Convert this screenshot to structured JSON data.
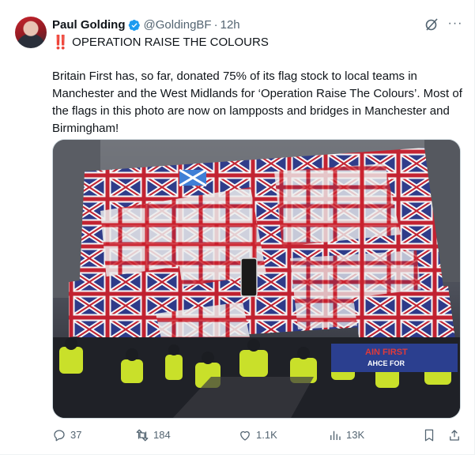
{
  "tweet": {
    "author_name": "Paul Golding",
    "handle": "@GoldingBF",
    "separator": "·",
    "time": "12h",
    "headline_emoji": "‼️",
    "headline": "OPERATION RAISE THE COLOURS",
    "body": "Britain First has, so far, donated 75% of its flag stock to local teams in Manchester and the West Midlands for ‘Operation Raise The Colours’. Most of the flags in this photo are now on lampposts and bridges in Manchester and Birmingham!",
    "more_label": "···"
  },
  "media": {
    "banner_line1": "AIN FIRST",
    "banner_line2": "AHCE FOR"
  },
  "stats": {
    "replies": "37",
    "reposts": "184",
    "likes": "1.1K",
    "views": "13K"
  },
  "icons": {
    "verified": "verified-badge-icon",
    "grok": "grok-icon",
    "more": "more-icon",
    "reply": "reply-icon",
    "repost": "repost-icon",
    "like": "like-icon",
    "views": "views-icon",
    "bookmark": "bookmark-icon",
    "share": "share-icon"
  },
  "colors": {
    "accent": "#1d9bf0",
    "text_secondary": "#536471",
    "alert_red": "#e0245e"
  }
}
